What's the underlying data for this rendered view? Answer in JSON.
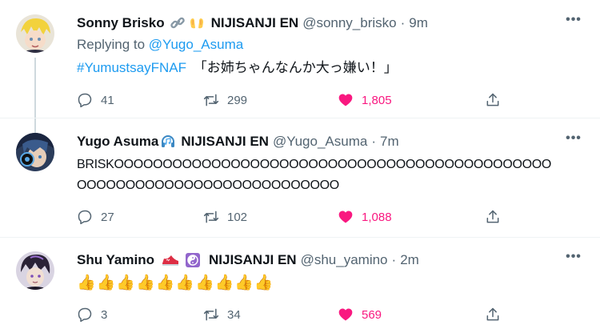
{
  "tweets": [
    {
      "name": "Sonny Brisko",
      "affil": "NIJISANJI EN",
      "handle": "@sonny_brisko",
      "time": "9m",
      "replying_prefix": "Replying to",
      "replying_to": "@Yugo_Asuma",
      "hashtag": "#YumustsayFNAF",
      "text": "「お姉ちゃんなんか大っ嫌い！」",
      "replies": "41",
      "retweets": "299",
      "likes": "1,805"
    },
    {
      "name": "Yugo Asuma",
      "affil": "NIJISANJI EN",
      "handle": "@Yugo_Asuma",
      "time": "7m",
      "text_line1": "BRISKOOOOOOOOOOOOOOOOOOOOOOOOOOOOOOOOOOOOOOOOOOOOO",
      "text_line2": "OOOOOOOOOOOOOOOOOOOOOOOOOOO",
      "replies": "27",
      "retweets": "102",
      "likes": "1,088"
    },
    {
      "name": "Shu Yamino",
      "affil": "NIJISANJI EN",
      "handle": "@shu_yamino",
      "time": "2m",
      "text": "👍👍👍👍👍👍👍👍👍👍",
      "replies": "3",
      "retweets": "34",
      "likes": "569"
    }
  ],
  "dot": "·",
  "more_glyph": "•••",
  "colors": {
    "accent": "#1d9bf0",
    "like": "#f91880",
    "muted": "#536471"
  }
}
